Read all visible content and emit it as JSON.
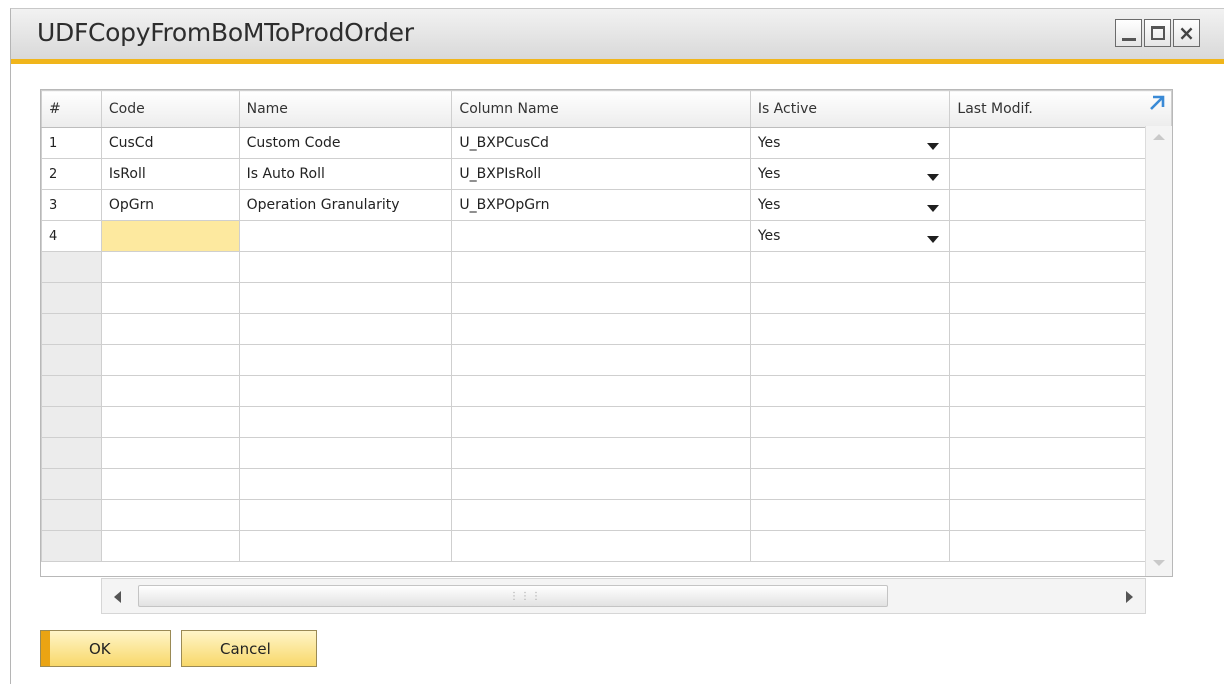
{
  "window": {
    "title": "UDFCopyFromBoMToProdOrder",
    "minimize_glyph": "",
    "close_glyph": "×",
    "accent_color": "#f0b51b"
  },
  "grid": {
    "columns": [
      "#",
      "Code",
      "Name",
      "Column Name",
      "Is Active",
      "Last Modif."
    ],
    "rows": [
      {
        "num": "1",
        "code": "CusCd",
        "name": "Custom Code",
        "column_name": "U_BXPCusCd",
        "is_active": "Yes",
        "last_modif": ""
      },
      {
        "num": "2",
        "code": "IsRoll",
        "name": "Is Auto Roll",
        "column_name": "U_BXPIsRoll",
        "is_active": "Yes",
        "last_modif": ""
      },
      {
        "num": "3",
        "code": "OpGrn",
        "name": "Operation Granularity",
        "column_name": "U_BXPOpGrn",
        "is_active": "Yes",
        "last_modif": ""
      },
      {
        "num": "4",
        "code": "",
        "name": "",
        "column_name": "",
        "is_active": "Yes",
        "last_modif": ""
      }
    ],
    "empty_row_count": 10,
    "focus_cell_color": "#fde99f",
    "expand_icon": "expand-arrow-icon"
  },
  "buttons": {
    "ok": "OK",
    "cancel": "Cancel"
  }
}
